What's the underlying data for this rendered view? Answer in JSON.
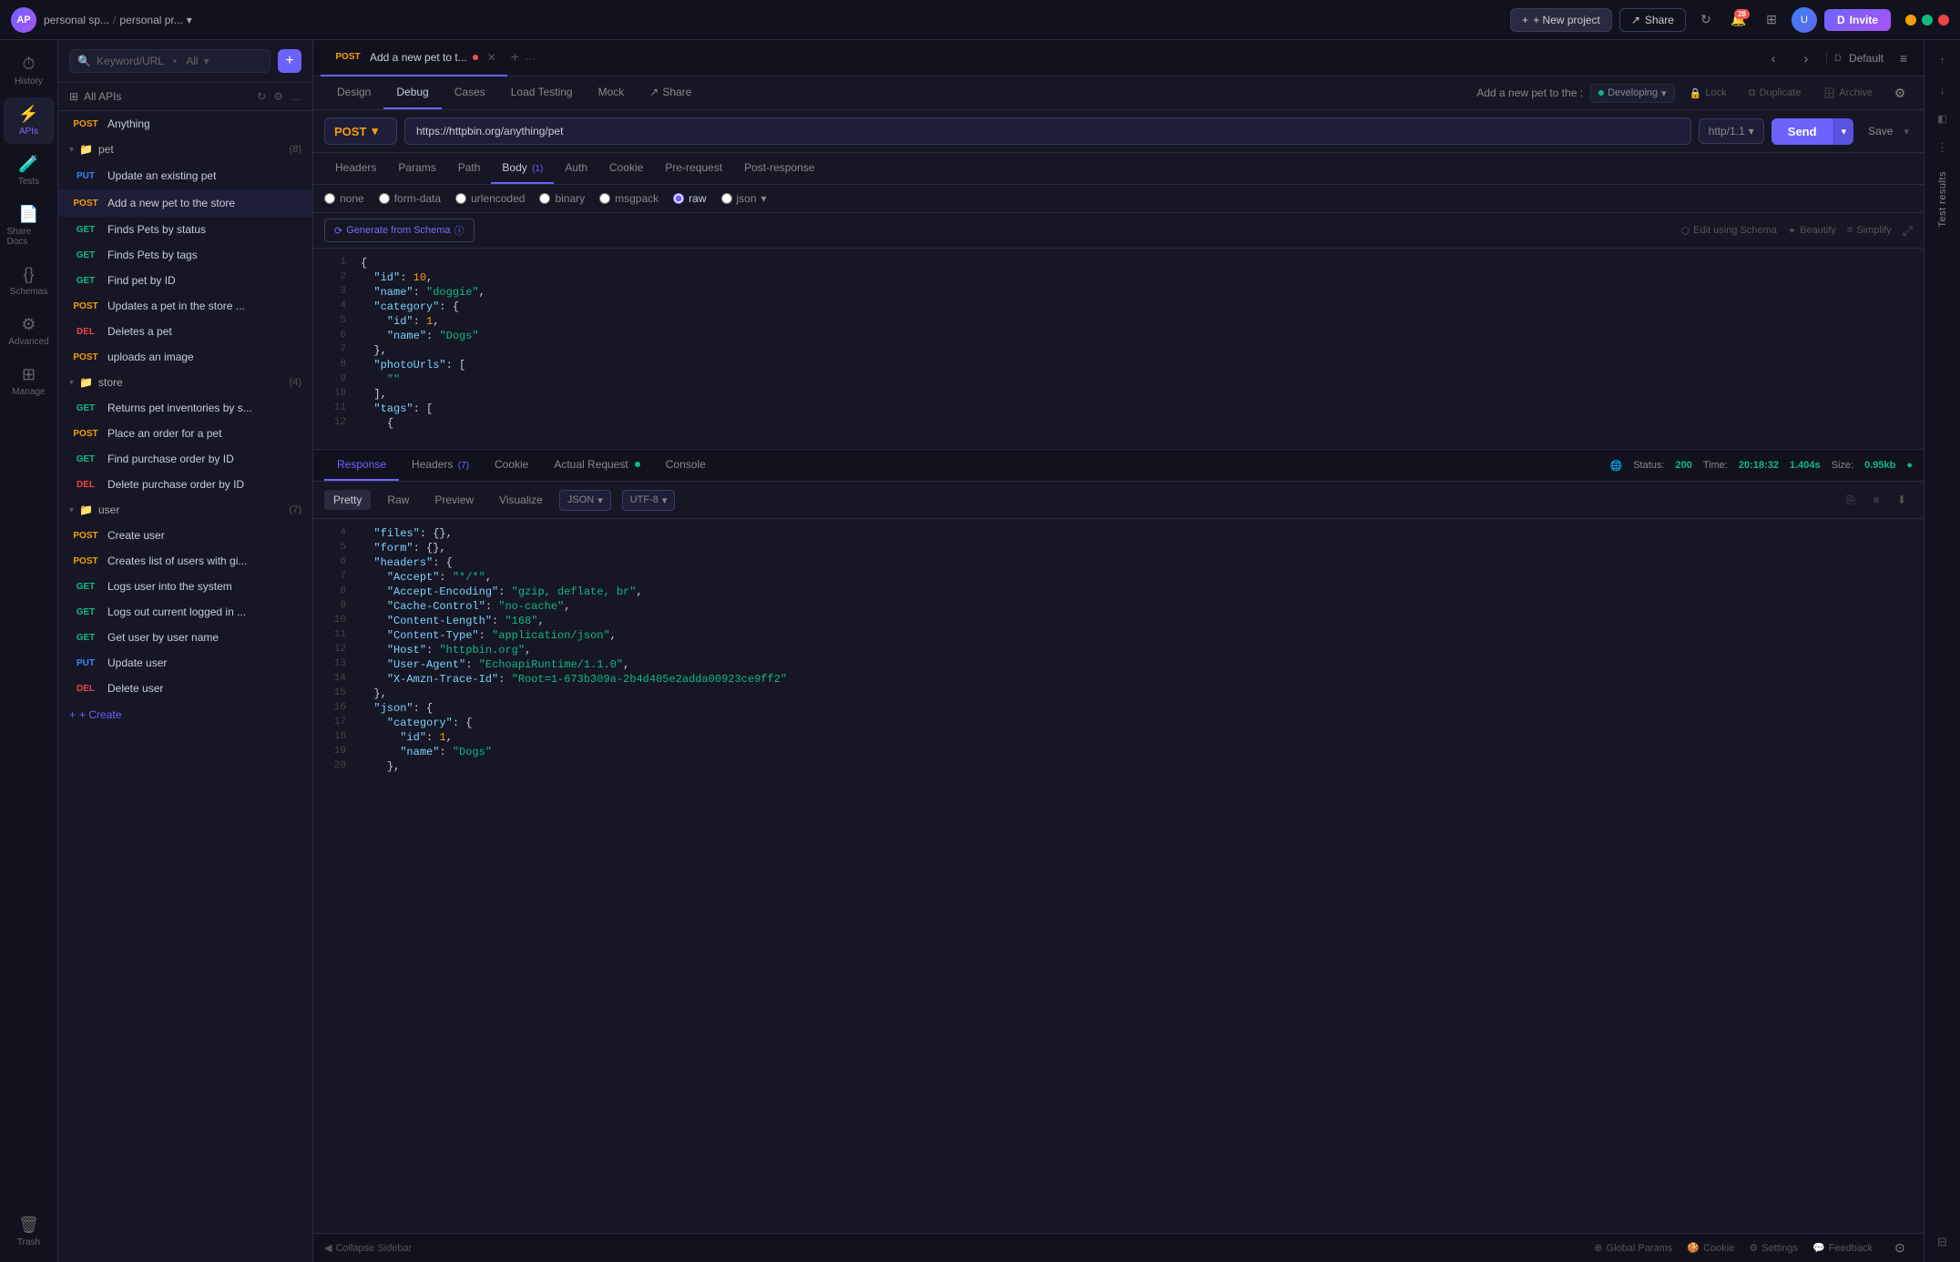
{
  "topbar": {
    "avatar_initials": "AP",
    "breadcrumb_space": "personal sp...",
    "breadcrumb_project": "personal pr...",
    "btn_new_project": "+ New project",
    "btn_share": "Share",
    "btn_invite": "Invite",
    "notification_count": "28"
  },
  "icon_sidebar": {
    "items": [
      {
        "id": "history",
        "icon": "⏱",
        "label": "History"
      },
      {
        "id": "apis",
        "icon": "⚡",
        "label": "APIs"
      },
      {
        "id": "tests",
        "icon": "🧪",
        "label": "Tests"
      },
      {
        "id": "share-docs",
        "icon": "📄",
        "label": "Share Docs"
      },
      {
        "id": "schemas",
        "icon": "{}",
        "label": "Schemas"
      },
      {
        "id": "advanced",
        "icon": "⚙",
        "label": "Advanced"
      },
      {
        "id": "manage",
        "icon": "⊞",
        "label": "Manage"
      },
      {
        "id": "trash",
        "icon": "🗑",
        "label": "Trash"
      }
    ]
  },
  "api_sidebar": {
    "search_placeholder": "Keyword/URL",
    "filter_label": "All",
    "title": "All APIs",
    "top_item": {
      "method": "POST",
      "name": "Anything"
    },
    "groups": [
      {
        "name": "pet",
        "count": 8,
        "items": [
          {
            "method": "PUT",
            "name": "Update an existing pet"
          },
          {
            "method": "POST",
            "name": "Add a new pet to the store",
            "active": true
          },
          {
            "method": "GET",
            "name": "Finds Pets by status"
          },
          {
            "method": "GET",
            "name": "Finds Pets by tags"
          },
          {
            "method": "GET",
            "name": "Find pet by ID"
          },
          {
            "method": "POST",
            "name": "Updates a pet in the store ..."
          },
          {
            "method": "DEL",
            "name": "Deletes a pet"
          },
          {
            "method": "POST",
            "name": "uploads an image"
          }
        ]
      },
      {
        "name": "store",
        "count": 4,
        "items": [
          {
            "method": "GET",
            "name": "Returns pet inventories by s..."
          },
          {
            "method": "POST",
            "name": "Place an order for a pet"
          },
          {
            "method": "GET",
            "name": "Find purchase order by ID"
          },
          {
            "method": "DEL",
            "name": "Delete purchase order by ID"
          }
        ]
      },
      {
        "name": "user",
        "count": 7,
        "items": [
          {
            "method": "POST",
            "name": "Create user"
          },
          {
            "method": "POST",
            "name": "Creates list of users with gi..."
          },
          {
            "method": "GET",
            "name": "Logs user into the system"
          },
          {
            "method": "GET",
            "name": "Logs out current logged in ..."
          },
          {
            "method": "GET",
            "name": "Get user by user name"
          },
          {
            "method": "PUT",
            "name": "Update user"
          },
          {
            "method": "DEL",
            "name": "Delete user"
          }
        ]
      }
    ],
    "create_btn": "+ Create"
  },
  "tab_bar": {
    "tabs": [
      {
        "label": "POST Add a new pet to t...",
        "has_dot": true,
        "active": true
      }
    ],
    "add_icon": "+",
    "more_icon": "..."
  },
  "api_nav": {
    "tabs": [
      "Design",
      "Debug",
      "Cases",
      "Load Testing",
      "Mock",
      "Share"
    ],
    "active_tab": "Debug",
    "title": "Add a new pet to the :",
    "environment": "Developing",
    "actions": [
      "Lock",
      "Duplicate",
      "Archive"
    ]
  },
  "request": {
    "method": "POST",
    "url": "https://httpbin.org/anything/pet",
    "http_version": "http/1.1",
    "send_btn": "Send",
    "save_btn": "Save"
  },
  "body_tabs": {
    "tabs": [
      {
        "label": "Headers"
      },
      {
        "label": "Params"
      },
      {
        "label": "Path"
      },
      {
        "label": "Body",
        "count": 1,
        "active": true
      },
      {
        "label": "Auth"
      },
      {
        "label": "Cookie"
      },
      {
        "label": "Pre-request"
      },
      {
        "label": "Post-response"
      }
    ]
  },
  "body_types": {
    "options": [
      "none",
      "form-data",
      "urlencoded",
      "binary",
      "msgpack",
      "raw",
      "json"
    ],
    "selected": "raw"
  },
  "schema_bar": {
    "generate_btn": "⟳ Generate from Schema ⓘ",
    "edit_schema": "⬡ Edit using Schema",
    "beautify": "✦ Beautify",
    "simplify": "≡ Simplify"
  },
  "code_body": {
    "lines": [
      {
        "num": 1,
        "content": "{"
      },
      {
        "num": 2,
        "content": "  \"id\": 10,"
      },
      {
        "num": 3,
        "content": "  \"name\": \"doggie\","
      },
      {
        "num": 4,
        "content": "  \"category\": {"
      },
      {
        "num": 5,
        "content": "    \"id\": 1,"
      },
      {
        "num": 6,
        "content": "    \"name\": \"Dogs\""
      },
      {
        "num": 7,
        "content": "  },"
      },
      {
        "num": 8,
        "content": "  \"photoUrls\": ["
      },
      {
        "num": 9,
        "content": "    \"\""
      },
      {
        "num": 10,
        "content": "  ],"
      },
      {
        "num": 11,
        "content": "  \"tags\": ["
      },
      {
        "num": 12,
        "content": "    {"
      }
    ]
  },
  "response": {
    "tabs": [
      "Response",
      "Headers",
      "Cookie",
      "Actual Request",
      "Console"
    ],
    "active_tab": "Response",
    "header_count": 7,
    "actual_request_dot": true,
    "status_code": "200",
    "time": "20:18:32",
    "duration": "1.404s",
    "size": "0.95kb",
    "format_tabs": [
      "Pretty",
      "Raw",
      "Preview",
      "Visualize"
    ],
    "active_format": "Pretty",
    "format": "JSON",
    "encoding": "UTF-8",
    "lines": [
      {
        "num": 4,
        "content": "  \"files\": {},"
      },
      {
        "num": 5,
        "content": "  \"form\": {},"
      },
      {
        "num": 6,
        "content": "  \"headers\": {"
      },
      {
        "num": 7,
        "content": "    \"Accept\": \"*/*\","
      },
      {
        "num": 8,
        "content": "    \"Accept-Encoding\": \"gzip, deflate, br\","
      },
      {
        "num": 9,
        "content": "    \"Cache-Control\": \"no-cache\","
      },
      {
        "num": 10,
        "content": "    \"Content-Length\": \"168\","
      },
      {
        "num": 11,
        "content": "    \"Content-Type\": \"application/json\","
      },
      {
        "num": 12,
        "content": "    \"Host\": \"httpbin.org\","
      },
      {
        "num": 13,
        "content": "    \"User-Agent\": \"EchoapiRuntime/1.1.0\","
      },
      {
        "num": 14,
        "content": "    \"X-Amzn-Trace-Id\": \"Root=1-673b309a-2b4d405e2adda00923ce9ff2\""
      },
      {
        "num": 15,
        "content": "  },"
      },
      {
        "num": 16,
        "content": "  \"json\": {"
      },
      {
        "num": 17,
        "content": "    \"category\": {"
      },
      {
        "num": 18,
        "content": "      \"id\": 1,"
      },
      {
        "num": 19,
        "content": "      \"name\": \"Dogs\""
      },
      {
        "num": 20,
        "content": "    },"
      }
    ]
  },
  "bottom_bar": {
    "collapse_sidebar": "◀ Collapse Sidebar",
    "global_params": "⊕ Global Params",
    "cookie": "🍪 Cookie",
    "settings": "⚙ Settings",
    "feedback": "💬 Feedback"
  }
}
